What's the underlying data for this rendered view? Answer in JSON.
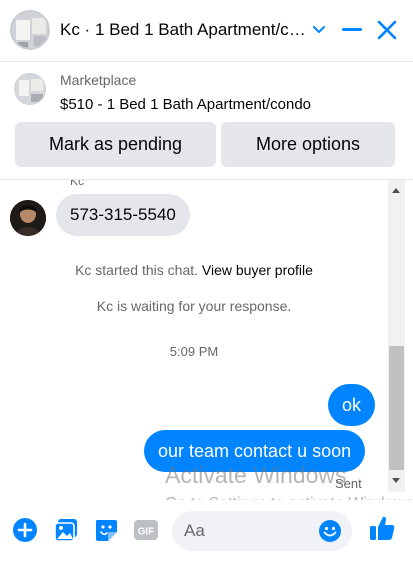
{
  "header": {
    "title": "Kc · 1 Bed 1 Bath Apartment/condo",
    "icons": [
      "avatar",
      "chevron-down-icon",
      "minimize-icon",
      "close-icon"
    ]
  },
  "listing": {
    "source": "Marketplace",
    "price_title": "$510 - 1 Bed 1 Bath Apartment/condo",
    "buttons": {
      "pending": "Mark as pending",
      "more": "More options"
    }
  },
  "conversation": {
    "sender_name": "Kc",
    "incoming_message": "573-315-5540",
    "system": {
      "started_prefix": "Kc started this chat.",
      "view_profile": "View buyer profile",
      "waiting": "Kc is waiting for your response."
    },
    "timestamp": "5:09 PM",
    "outgoing": [
      "ok",
      "our team contact u soon"
    ],
    "status": "Sent"
  },
  "watermark": {
    "line1": "Activate Windows",
    "line2": "Go to Settings to activate Windows."
  },
  "composer": {
    "placeholder": "Aa",
    "actions": [
      "plus-icon",
      "photo-icon",
      "sticker-icon",
      "gif-icon",
      "emoji-icon",
      "thumbs-up-icon"
    ]
  },
  "colors": {
    "accent": "#0084ff",
    "bubble_in": "#e4e6eb",
    "muted_text": "#65676b",
    "button_bg": "#e4e6eb"
  }
}
